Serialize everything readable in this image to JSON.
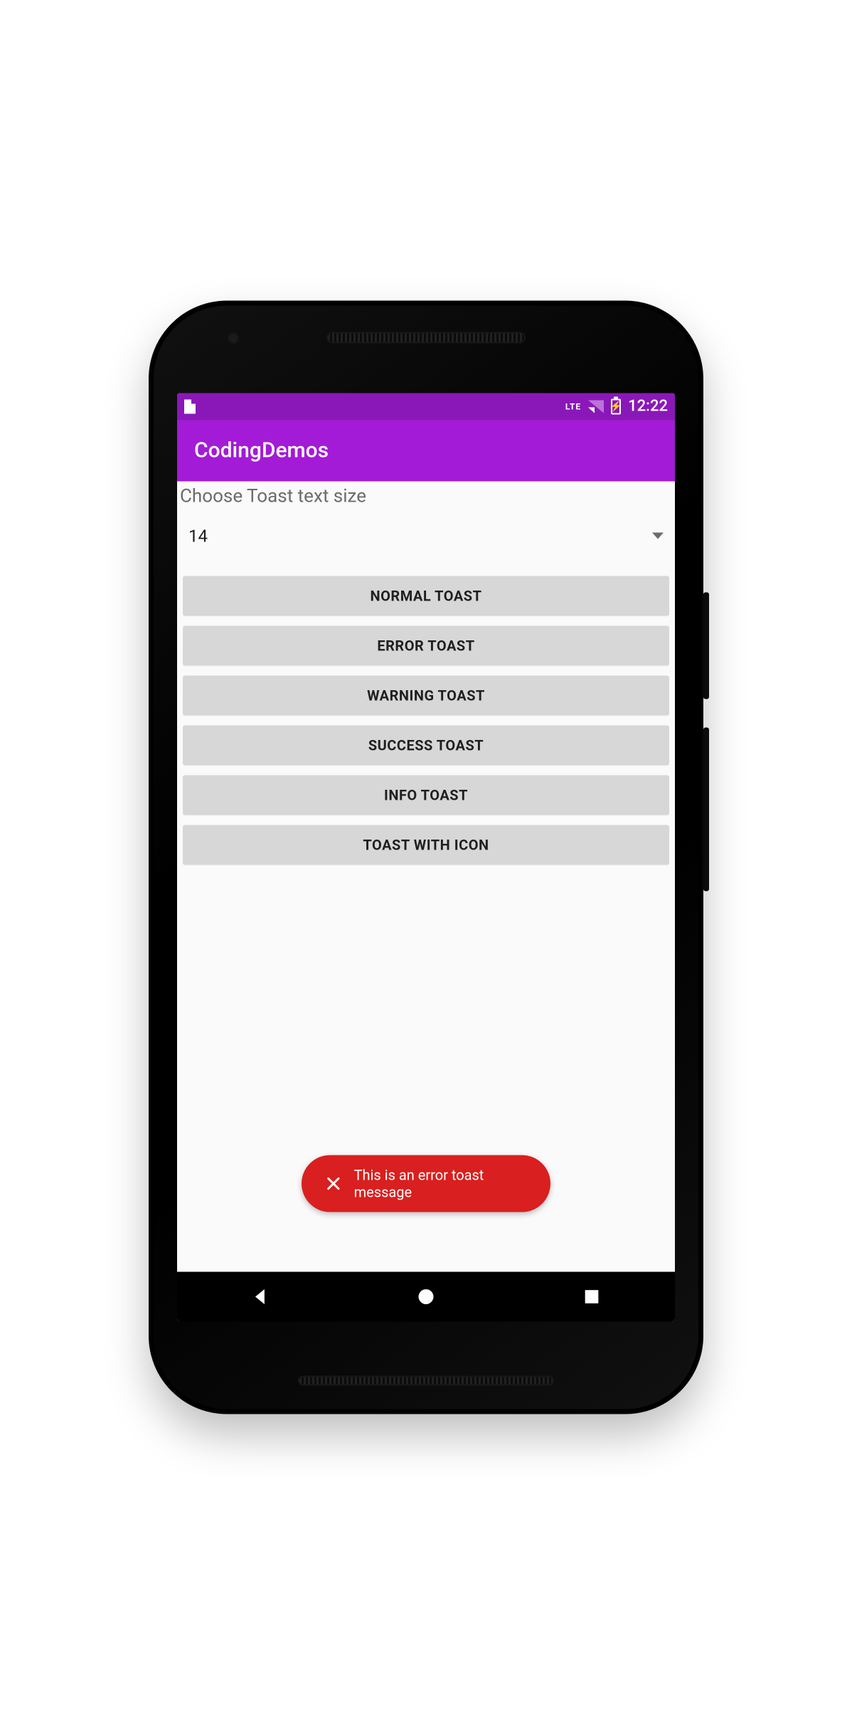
{
  "statusbar": {
    "network_label": "LTE",
    "time": "12:22"
  },
  "appbar": {
    "title": "CodingDemos"
  },
  "content": {
    "section_label": "Choose Toast text size",
    "text_size_value": "14"
  },
  "buttons": {
    "normal": "NORMAL TOAST",
    "error": "ERROR TOAST",
    "warning": "WARNING TOAST",
    "success": "SUCCESS TOAST",
    "info": "INFO TOAST",
    "withicon": "TOAST WITH ICON"
  },
  "toast": {
    "message": "This is an error toast message",
    "bg_color": "#d91f1f"
  },
  "colors": {
    "status_bar": "#8a18b8",
    "app_bar": "#a31bd6",
    "button_bg": "#d7d7d7"
  }
}
